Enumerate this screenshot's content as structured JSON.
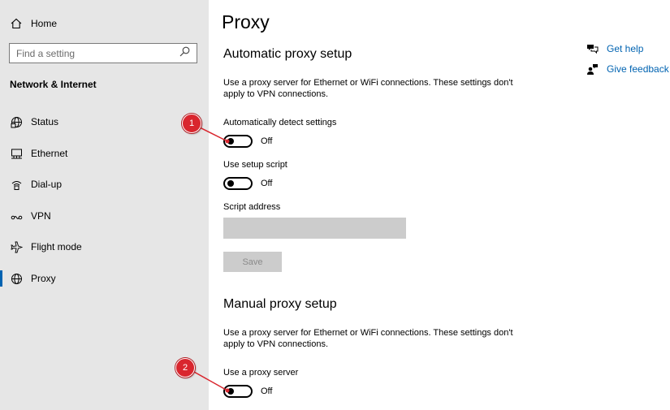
{
  "sidebar": {
    "home": {
      "label": "Home",
      "icon": "home-icon"
    },
    "search": {
      "placeholder": "Find a setting",
      "icon": "search-icon"
    },
    "section_title": "Network & Internet",
    "items": [
      {
        "label": "Status",
        "icon": "globe-status-icon",
        "active": false
      },
      {
        "label": "Ethernet",
        "icon": "ethernet-icon",
        "active": false
      },
      {
        "label": "Dial-up",
        "icon": "dial-up-icon",
        "active": false
      },
      {
        "label": "VPN",
        "icon": "vpn-icon",
        "active": false
      },
      {
        "label": "Flight mode",
        "icon": "airplane-icon",
        "active": false
      },
      {
        "label": "Proxy",
        "icon": "globe-icon",
        "active": true
      }
    ]
  },
  "main": {
    "title": "Proxy",
    "automatic": {
      "heading": "Automatic proxy setup",
      "description": "Use a proxy server for Ethernet or WiFi connections. These settings don't apply to VPN connections.",
      "auto_detect": {
        "label": "Automatically detect settings",
        "state": "Off"
      },
      "setup_script": {
        "label": "Use setup script",
        "state": "Off"
      },
      "script_address": {
        "label": "Script address",
        "value": ""
      },
      "save_label": "Save"
    },
    "manual": {
      "heading": "Manual proxy setup",
      "description": "Use a proxy server for Ethernet or WiFi connections. These settings don't apply to VPN connections.",
      "use_proxy": {
        "label": "Use a proxy server",
        "state": "Off"
      }
    }
  },
  "help": {
    "get_help": "Get help",
    "give_feedback": "Give feedback"
  },
  "callouts": [
    "1",
    "2"
  ],
  "colors": {
    "accent": "#0063b1",
    "callout": "#d9262e",
    "sidebar_bg": "#e6e6e6"
  }
}
